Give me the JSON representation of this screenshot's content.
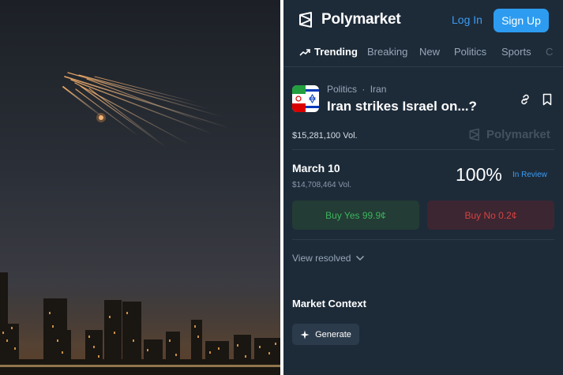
{
  "header": {
    "logo_text": "Polymarket",
    "login_label": "Log In",
    "signup_label": "Sign Up"
  },
  "nav": {
    "tabs": [
      {
        "label": "Trending",
        "icon": "trending-up-icon",
        "active": true
      },
      {
        "label": "Breaking"
      },
      {
        "label": "New"
      },
      {
        "label": "Politics"
      },
      {
        "label": "Sports"
      },
      {
        "label": "C"
      }
    ]
  },
  "market": {
    "category": "Politics",
    "subcategory": "Iran",
    "separator": "·",
    "title": "Iran strikes Israel on...?",
    "volume": "$15,281,100 Vol.",
    "watermark": "Polymarket",
    "outcome": {
      "date": "March 10",
      "volume": "$14,708,464 Vol.",
      "probability": "100%",
      "status": "In Review",
      "buy_yes": "Buy Yes 99.9¢",
      "buy_no": "Buy No 0.2¢"
    },
    "view_resolved": "View resolved",
    "context_title": "Market Context",
    "generate_label": "Generate"
  },
  "colors": {
    "background": "#1d2b39",
    "accent_blue": "#2d9cf0",
    "yes_green": "#3cb55e",
    "no_red": "#d8423f"
  }
}
